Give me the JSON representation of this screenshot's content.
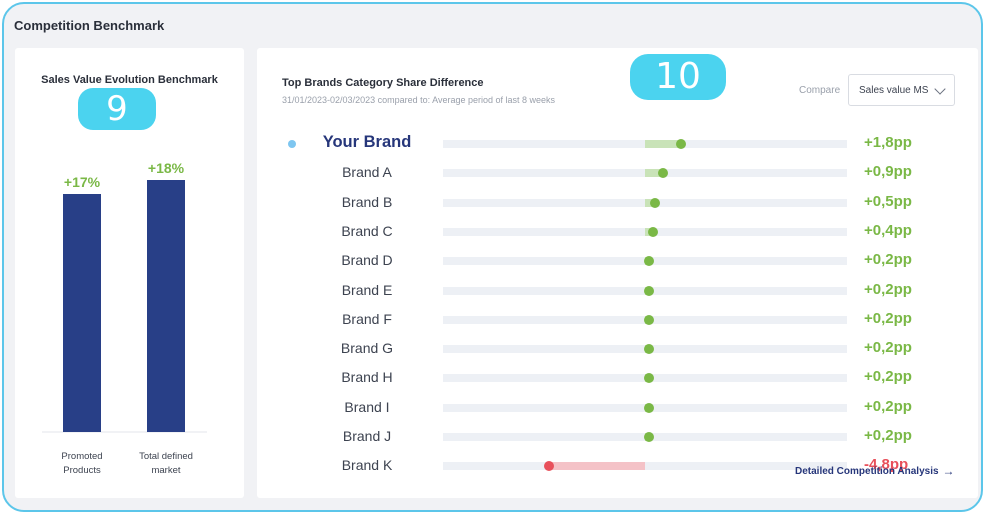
{
  "section": {
    "title": "Competition Benchmark"
  },
  "left_card": {
    "title": "Sales Value Evolution Benchmark",
    "badge": "9"
  },
  "chart_data": {
    "type": "bar",
    "title": "Sales Value Evolution Benchmark",
    "categories": [
      "Promoted\nProducts",
      "Total defined\nmarket"
    ],
    "values": [
      17,
      18
    ],
    "data_labels": [
      "+17%",
      "+18%"
    ],
    "ylim": [
      0,
      23
    ],
    "bar_color": "#283f87",
    "label_color": "#7ab846"
  },
  "right_card": {
    "title": "Top Brands Category Share Difference",
    "subtitle": "31/01/2023-02/03/2023 compared to: Average period of last 8 weeks",
    "badge": "10",
    "compare_label": "Compare",
    "compare_value": "Sales value MS",
    "link_label": "Detailed Competition Analysis",
    "link_icon": "arrow-right-icon"
  },
  "brands": [
    {
      "name": "Your Brand",
      "value": 1.8,
      "label": "+1,8pp",
      "highlight": true
    },
    {
      "name": "Brand A",
      "value": 0.9,
      "label": "+0,9pp"
    },
    {
      "name": "Brand B",
      "value": 0.5,
      "label": "+0,5pp"
    },
    {
      "name": "Brand C",
      "value": 0.4,
      "label": "+0,4pp"
    },
    {
      "name": "Brand D",
      "value": 0.2,
      "label": "+0,2pp"
    },
    {
      "name": "Brand E",
      "value": 0.2,
      "label": "+0,2pp"
    },
    {
      "name": "Brand F",
      "value": 0.2,
      "label": "+0,2pp"
    },
    {
      "name": "Brand G",
      "value": 0.2,
      "label": "+0,2pp"
    },
    {
      "name": "Brand H",
      "value": 0.2,
      "label": "+0,2pp"
    },
    {
      "name": "Brand I",
      "value": 0.2,
      "label": "+0,2pp"
    },
    {
      "name": "Brand J",
      "value": 0.2,
      "label": "+0,2pp"
    },
    {
      "name": "Brand K",
      "value": -4.8,
      "label": "-4,8pp"
    }
  ],
  "colors": {
    "accent": "#5cc6ea",
    "positive": "#7ab846",
    "positive_fill": "#c9e3b8",
    "negative": "#e8505b",
    "negative_fill": "#f4c2c7",
    "brand_navy": "#26367a"
  }
}
